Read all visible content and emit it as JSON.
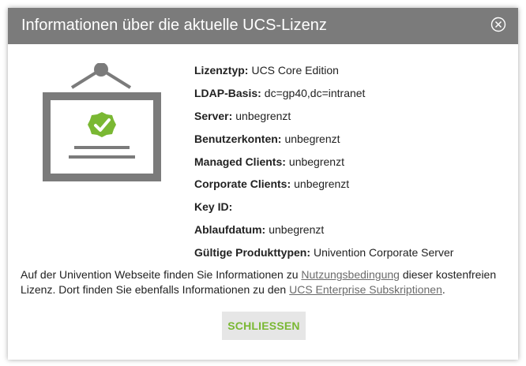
{
  "dialog": {
    "title": "Informationen über die aktuelle UCS-Lizenz",
    "close_icon": "close-circle-icon",
    "illustration_icon": "license-certificate-icon",
    "accent_color": "#7ab833",
    "titlebar_color": "#7b7b7b"
  },
  "license": {
    "rows": [
      {
        "key": "Lizenztyp:",
        "value": "UCS Core Edition"
      },
      {
        "key": "LDAP-Basis:",
        "value": "dc=gp40,dc=intranet"
      },
      {
        "key": "Server:",
        "value": "unbegrenzt"
      },
      {
        "key": "Benutzerkonten:",
        "value": "unbegrenzt"
      },
      {
        "key": "Managed Clients:",
        "value": "unbegrenzt"
      },
      {
        "key": "Corporate Clients:",
        "value": "unbegrenzt"
      },
      {
        "key": "Key ID:",
        "value": ""
      },
      {
        "key": "Ablaufdatum:",
        "value": "unbegrenzt"
      },
      {
        "key": "Gültige Produkttypen:",
        "value": "Univention Corporate Server"
      }
    ]
  },
  "note": {
    "part1": "Auf der Univention Webseite finden Sie Informationen zu ",
    "link1": "Nutzungsbedingung",
    "part2": " dieser kostenfreien Lizenz. Dort finden Sie ebenfalls Informationen zu den ",
    "link2": "UCS Enterprise Subskriptionen",
    "part3": "."
  },
  "buttons": {
    "close_label": "SCHLIESSEN"
  }
}
